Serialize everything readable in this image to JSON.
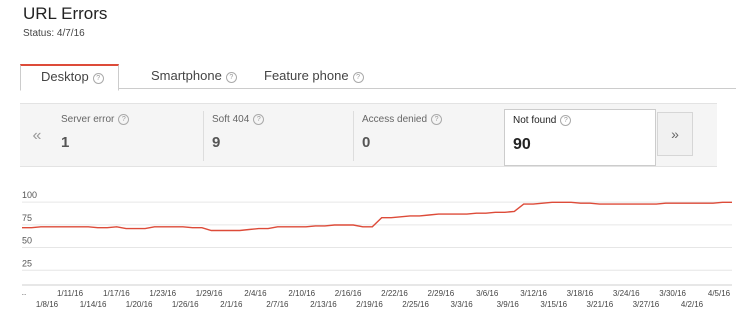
{
  "page": {
    "title": "URL Errors",
    "status": "Status: 4/7/16"
  },
  "tabs": [
    {
      "label": "Desktop",
      "active": true
    },
    {
      "label": "Smartphone",
      "active": false
    },
    {
      "label": "Feature phone",
      "active": false
    }
  ],
  "help_glyph": "?",
  "nav": {
    "prev": "«",
    "next": "»"
  },
  "stats": [
    {
      "label": "Server error",
      "value": "1"
    },
    {
      "label": "Soft 404",
      "value": "9"
    },
    {
      "label": "Access denied",
      "value": "0"
    },
    {
      "label": "Not found",
      "value": "90",
      "active": true
    }
  ],
  "colors": {
    "line": "#dd4b39",
    "accent": "#dd4b39"
  },
  "chart_data": {
    "type": "line",
    "y_ticks": [
      100,
      75,
      50,
      25
    ],
    "ylim": [
      0,
      110
    ],
    "x_labels_upper": [
      "1/11/16",
      "1/17/16",
      "1/23/16",
      "1/29/16",
      "2/4/16",
      "2/10/16",
      "2/16/16",
      "2/22/16",
      "2/29/16",
      "3/6/16",
      "3/12/16",
      "3/18/16",
      "3/24/16",
      "3/30/16",
      "4/5/16"
    ],
    "x_labels_lower": [
      "1/8/16",
      "1/14/16",
      "1/20/16",
      "1/26/16",
      "2/1/16",
      "2/7/16",
      "2/13/16",
      "2/19/16",
      "2/25/16",
      "3/3/16",
      "3/9/16",
      "3/15/16",
      "3/21/16",
      "3/27/16",
      "4/2/16"
    ],
    "leading_label": "..",
    "series": [
      {
        "values": [
          63,
          63,
          64,
          64,
          64,
          64,
          64,
          64,
          63,
          63,
          64,
          62,
          62,
          62,
          64,
          64,
          64,
          64,
          63,
          63,
          60,
          60,
          60,
          60,
          61,
          62,
          62,
          64,
          64,
          64,
          64,
          65,
          65,
          66,
          66,
          66,
          64,
          64,
          74,
          74,
          75,
          76,
          76,
          77,
          78,
          78,
          78,
          78,
          79,
          79,
          80,
          80,
          81,
          89,
          89,
          90,
          91,
          91,
          91,
          90,
          90,
          89,
          89,
          89,
          89,
          89,
          89,
          89,
          90,
          90,
          90,
          90,
          90,
          90,
          91,
          91
        ]
      }
    ]
  }
}
